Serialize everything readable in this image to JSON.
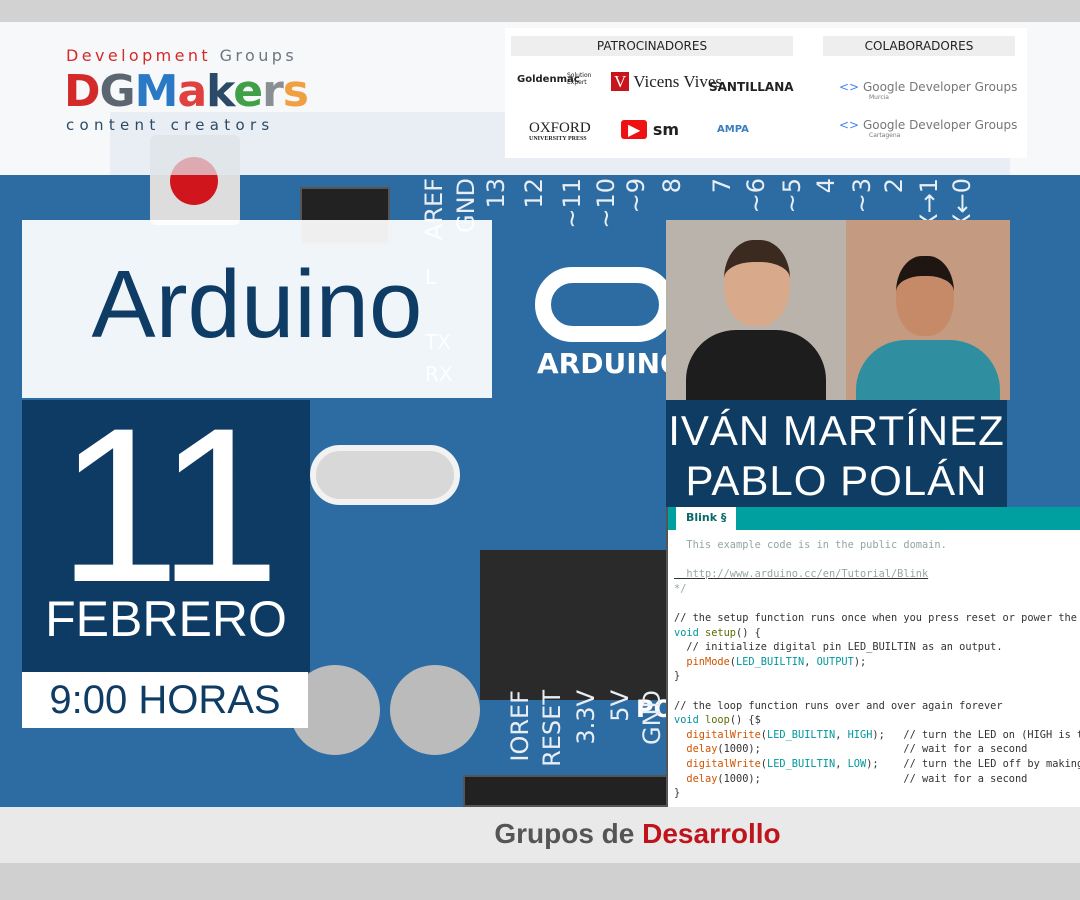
{
  "logo": {
    "line1_red": "Development",
    "line1_gray": "Groups",
    "letters": [
      {
        "ch": "D",
        "color": "#d42a2a"
      },
      {
        "ch": "G",
        "color": "#5c6670"
      },
      {
        "ch": "M",
        "color": "#2b78c4"
      },
      {
        "ch": "a",
        "color": "#e04040"
      },
      {
        "ch": "k",
        "color": "#2b4a68"
      },
      {
        "ch": "e",
        "color": "#3fa048"
      },
      {
        "ch": "r",
        "color": "#8a8f94"
      },
      {
        "ch": "s",
        "color": "#f0a040"
      }
    ],
    "tagline": "content creators"
  },
  "sponsors": {
    "heading": "PATROCINADORES",
    "logos": [
      "Goldenmac",
      "Solution Expert",
      "Vicens Vives",
      "SANTILLANA",
      "OXFORD",
      "UNIVERSITY PRESS",
      "sm",
      "AMPA"
    ]
  },
  "collaborators": {
    "heading": "COLABORADORES",
    "logos": [
      {
        "name": "Google Developer Groups",
        "city": "Murcia"
      },
      {
        "name": "Google Developer Groups",
        "city": "Cartagena"
      }
    ]
  },
  "board": {
    "top_pins": [
      "AREF",
      "GND",
      "13",
      "12",
      "~11",
      "~10",
      "~9",
      "8",
      "7",
      "~6",
      "~5",
      "4",
      "~3",
      "2",
      "TX→1",
      "RX←0"
    ],
    "bottom_pins": [
      "IOREF",
      "RESET",
      "3.3V",
      "5V",
      "GND"
    ],
    "leds": [
      "L",
      "TX",
      "RX"
    ],
    "logo_text": "ARDUINO",
    "power_label": "PO"
  },
  "event": {
    "title": "Arduino",
    "day": "11",
    "month": "FEBRERO",
    "time": "9:00 HORAS"
  },
  "speakers": [
    "IVÁN MARTÍNEZ",
    "PABLO POLÁN"
  ],
  "code": {
    "tab": "Blink §",
    "lines": [
      [
        [
          "c-com",
          "  This example code is in the public domain."
        ]
      ],
      [
        [
          "",
          ""
        ]
      ],
      [
        [
          "c-com",
          "  http://www.arduino.cc/en/Tutorial/Blink"
        ]
      ],
      [
        [
          "c-com",
          "*/"
        ]
      ],
      [
        [
          "",
          ""
        ]
      ],
      [
        [
          "",
          "// the setup function runs once when you press reset or power the board"
        ]
      ],
      [
        [
          "c-kw",
          "void "
        ],
        [
          "c-st",
          "setup"
        ],
        [
          "",
          "() {"
        ]
      ],
      [
        [
          "",
          "  // initialize digital pin LED_BUILTIN as an output."
        ]
      ],
      [
        [
          "c-fn",
          "  pinMode"
        ],
        [
          "",
          "("
        ],
        [
          "c-kw",
          "LED_BUILTIN"
        ],
        [
          "",
          ", "
        ],
        [
          "c-kw",
          "OUTPUT"
        ],
        [
          "",
          ");"
        ]
      ],
      [
        [
          "",
          "}"
        ]
      ],
      [
        [
          "",
          ""
        ]
      ],
      [
        [
          "",
          "// the loop function runs over and over again forever"
        ]
      ],
      [
        [
          "c-kw",
          "void "
        ],
        [
          "c-st",
          "loop"
        ],
        [
          "",
          "() {$"
        ]
      ],
      [
        [
          "c-fn",
          "  digitalWrite"
        ],
        [
          "",
          "("
        ],
        [
          "c-kw",
          "LED_BUILTIN"
        ],
        [
          "",
          ", "
        ],
        [
          "c-kw",
          "HIGH"
        ],
        [
          "",
          ");   // turn the LED on (HIGH is the voltage level)"
        ]
      ],
      [
        [
          "c-fn",
          "  delay"
        ],
        [
          "",
          "(1000);                       // wait for a second"
        ]
      ],
      [
        [
          "c-fn",
          "  digitalWrite"
        ],
        [
          "",
          "("
        ],
        [
          "c-kw",
          "LED_BUILTIN"
        ],
        [
          "",
          ", "
        ],
        [
          "c-kw",
          "LOW"
        ],
        [
          "",
          ");    // turn the LED off by making the voltage LOW"
        ]
      ],
      [
        [
          "c-fn",
          "  delay"
        ],
        [
          "",
          "(1000);                       // wait for a second"
        ]
      ],
      [
        [
          "",
          "}"
        ]
      ]
    ]
  },
  "footer": {
    "text_gray": "Grupos de ",
    "text_red": "Desarrollo"
  },
  "colors": {
    "dark_blue": "#0e3c65",
    "board_blue": "#2d6ca2",
    "accent_red": "#c0141c",
    "ide_teal": "#00a0a0"
  }
}
